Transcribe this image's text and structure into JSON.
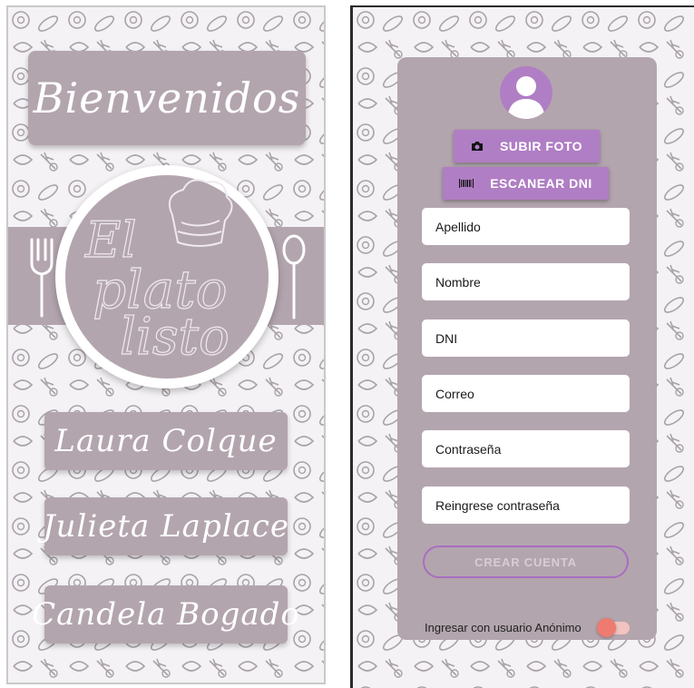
{
  "left_screen": {
    "welcome": "Bienvenidos",
    "logo_lines": [
      "El",
      "plato",
      "listo"
    ],
    "team": [
      "Laura Colque",
      "Julieta Laplace",
      "Candela Bogado"
    ]
  },
  "right_screen": {
    "buttons": {
      "upload_photo": "SUBIR FOTO",
      "scan_dni": "ESCANEAR DNI",
      "create_account": "CREAR CUENTA"
    },
    "fields": [
      {
        "placeholder": "Apellido"
      },
      {
        "placeholder": "Nombre"
      },
      {
        "placeholder": "DNI"
      },
      {
        "placeholder": "Correo"
      },
      {
        "placeholder": "Contraseña"
      },
      {
        "placeholder": "Reingrese contraseña"
      }
    ],
    "anonymous_toggle": {
      "label": "Ingresar con usuario Anónimo",
      "on": false
    }
  },
  "colors": {
    "card_mauve": "#b3a5ae",
    "accent_purple": "#b07ec4",
    "toggle_thumb": "#ee7b6f",
    "toggle_track": "#f2c3c0"
  },
  "icons": [
    "camera-icon",
    "barcode-icon",
    "user-avatar-icon",
    "fork-icon",
    "spoon-icon",
    "chef-hat-icon"
  ]
}
